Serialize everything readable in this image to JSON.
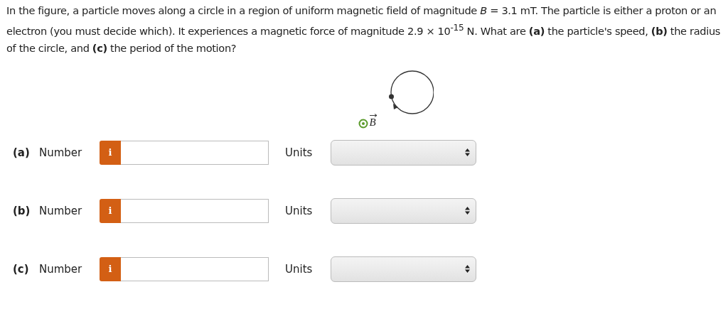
{
  "question": "In the figure, a particle moves along a circle in a region of uniform magnetic field of magnitude *B* = 3.1 mT. The particle is either a proton or an electron (you must decide which). It experiences a magnetic force of magnitude 2.9 × 10$^{-15}$ N. What are **(a)** the particle's speed, **(b)** the radius of the circle, and **(c)** the period of the motion?",
  "figure": {
    "field_label": "B"
  },
  "answers": [
    {
      "part": "(a)",
      "number_label": "Number",
      "info": "i",
      "units_label": "Units"
    },
    {
      "part": "(b)",
      "number_label": "Number",
      "info": "i",
      "units_label": "Units"
    },
    {
      "part": "(c)",
      "number_label": "Number",
      "info": "i",
      "units_label": "Units"
    }
  ]
}
